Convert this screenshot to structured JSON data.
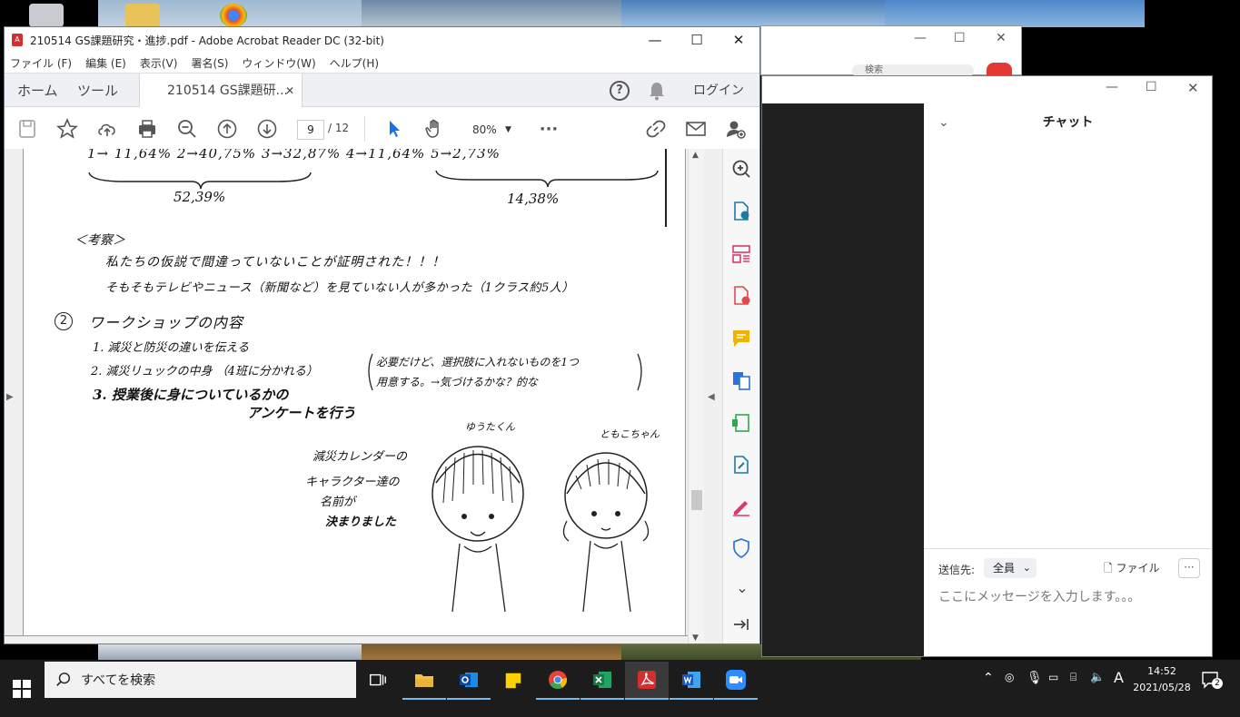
{
  "acrobat": {
    "title": "210514 GS課題研究・進捗.pdf - Adobe Acrobat Reader DC (32-bit)",
    "menu": [
      "ファイル (F)",
      "編集 (E)",
      "表示(V)",
      "署名(S)",
      "ウィンドウ(W)",
      "ヘルプ(H)"
    ],
    "tabs": {
      "home": "ホーム",
      "tools": "ツール",
      "document": "210514 GS課題研..."
    },
    "login": "ログイン",
    "page_current": "9",
    "page_total": "/  12",
    "zoom": "80%"
  },
  "document": {
    "line1": "1→ 11,64%   2→40,75%   3→32,87%   4→11,64%   5→2,73%",
    "sum_left": "52,39%",
    "sum_right": "14,38%",
    "consider_heading": "＜考察＞",
    "consider_1": "私たちの仮説で間違っていないことが証明された！！！",
    "consider_2": "そもそもテレビやニュース（新聞など）を見ていない人が多かった（1クラス約5人）",
    "section_num": "2",
    "section_title": "ワークショップの内容",
    "item_1": "1. 減災と防災の違いを伝える",
    "item_2": "2. 減災リュックの中身 （4班に分かれる）",
    "item_2_note_a": "必要だけど、選択肢に入れないものを1つ",
    "item_2_note_b": "用意する。→気づけるかな？的な",
    "item_3a": "3. 授業後に身についているかの",
    "item_3b": "アンケートを行う",
    "caption_1": "減災カレンダーの",
    "caption_2": "キャラクター達の",
    "caption_3": "名前が",
    "caption_4": "決まりました",
    "char_boy": "ゆうたくん",
    "char_girl": "ともこちゃん"
  },
  "chat": {
    "title": "チャット",
    "send_to_label": "送信先:",
    "send_to_value": "全員",
    "file_label": "ファイル",
    "placeholder": "ここにメッセージを入力します。。。",
    "more": "···"
  },
  "background_window": {
    "search": "検索"
  },
  "taskbar": {
    "search_placeholder": "すべてを検索",
    "ime": "A",
    "time": "14:52",
    "date": "2021/05/28",
    "notification_count": "2"
  }
}
